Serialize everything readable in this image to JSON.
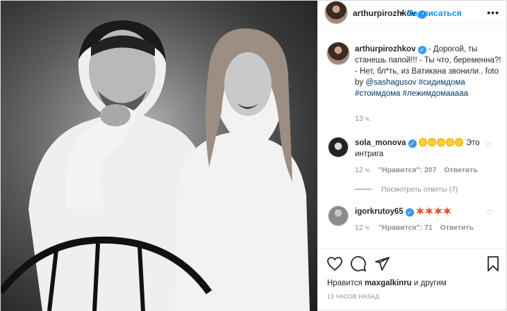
{
  "post": {
    "author": "arthurpirozhkov",
    "follow_label": "Подписаться",
    "separator": "•",
    "more_label": "•••"
  },
  "caption": {
    "username": "arthurpirozhkov",
    "text": "- Дорогой, ты станешь папой!!! - Ты что, беременна?! - Нет, бл*ть, из Ватикана звонили.. foto by",
    "mention": "@sashagusov",
    "hashtags": "#сидимдома #стоимдома #лежимдомааааа",
    "time": "13 ч."
  },
  "comments": [
    {
      "username": "sola_monova",
      "text": "Это интрига",
      "emoji_count": 5,
      "time": "12 ч.",
      "likes": "\"Нравится\": 207",
      "reply_label": "Ответить",
      "view_replies": "Посмотреть ответы (7)"
    },
    {
      "username": "igorkrutoy65",
      "emoji_count": 4,
      "time": "12 ч.",
      "likes": "\"Нравится\": 71",
      "reply_label": "Ответить"
    }
  ],
  "footer": {
    "likes_prefix": "Нравится",
    "likes_user": "maxgalkinru",
    "likes_suffix": "и другим",
    "posted_ago": "13 ЧАСОВ НАЗАД"
  },
  "icons": {
    "like": "heart-icon",
    "comment": "comment-icon",
    "share": "share-icon",
    "save": "bookmark-icon",
    "verified": "verified-badge-icon",
    "more": "more-options-icon"
  },
  "colors": {
    "accent": "#0095f6",
    "verified": "#3897f0",
    "muted": "#8e8e8e",
    "text": "#262626",
    "border": "#dbdbdb"
  }
}
